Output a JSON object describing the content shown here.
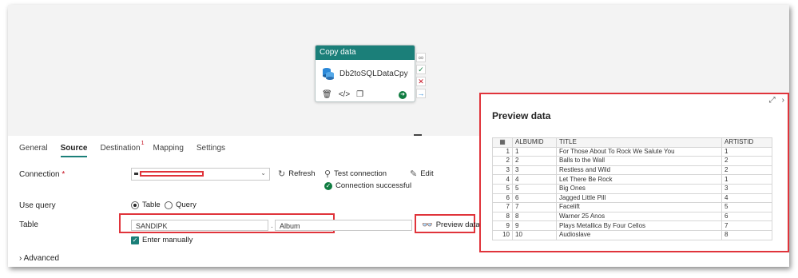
{
  "activity": {
    "header": "Copy data",
    "name": "Db2toSQLDataCpy",
    "icons": [
      "delete-icon",
      "code-icon",
      "copy-icon",
      "run-arrow-icon"
    ],
    "side_icons": [
      "link-icon",
      "success-check-icon",
      "failure-x-icon",
      "completion-arrow-icon"
    ]
  },
  "tabs": [
    {
      "label": "General"
    },
    {
      "label": "Source",
      "active": true
    },
    {
      "label": "Destination",
      "badge": "1"
    },
    {
      "label": "Mapping"
    },
    {
      "label": "Settings"
    }
  ],
  "connection": {
    "label": "Connection",
    "required_mark": "*",
    "refresh_label": "Refresh",
    "test_label": "Test connection",
    "edit_label": "Edit",
    "status": "Connection successful"
  },
  "use_query": {
    "label": "Use query",
    "options": [
      "Table",
      "Query"
    ],
    "selected": "Table"
  },
  "table": {
    "label": "Table",
    "schema": "SANDIPK",
    "separator": ".",
    "name": "Album",
    "preview_label": "Preview data",
    "enter_manually": "Enter manually"
  },
  "advanced": {
    "label": "Advanced"
  },
  "preview": {
    "title": "Preview data",
    "columns": [
      "ALBUMID",
      "TITLE",
      "ARTISTID"
    ],
    "rows": [
      [
        "1",
        "1",
        "For Those About To Rock We Salute You",
        "1"
      ],
      [
        "2",
        "2",
        "Balls to the Wall",
        "2"
      ],
      [
        "3",
        "3",
        "Restless and Wild",
        "2"
      ],
      [
        "4",
        "4",
        "Let There Be Rock",
        "1"
      ],
      [
        "5",
        "5",
        "Big Ones",
        "3"
      ],
      [
        "6",
        "6",
        "Jagged Little Pill",
        "4"
      ],
      [
        "7",
        "7",
        "Facelift",
        "5"
      ],
      [
        "8",
        "8",
        "Warner 25 Anos",
        "6"
      ],
      [
        "9",
        "9",
        "Plays Metallica By Four Cellos",
        "7"
      ],
      [
        "10",
        "10",
        "Audioslave",
        "8"
      ]
    ]
  },
  "colors": {
    "accent": "#1b7f79",
    "highlight": "#e0343b",
    "success": "#107c41"
  }
}
